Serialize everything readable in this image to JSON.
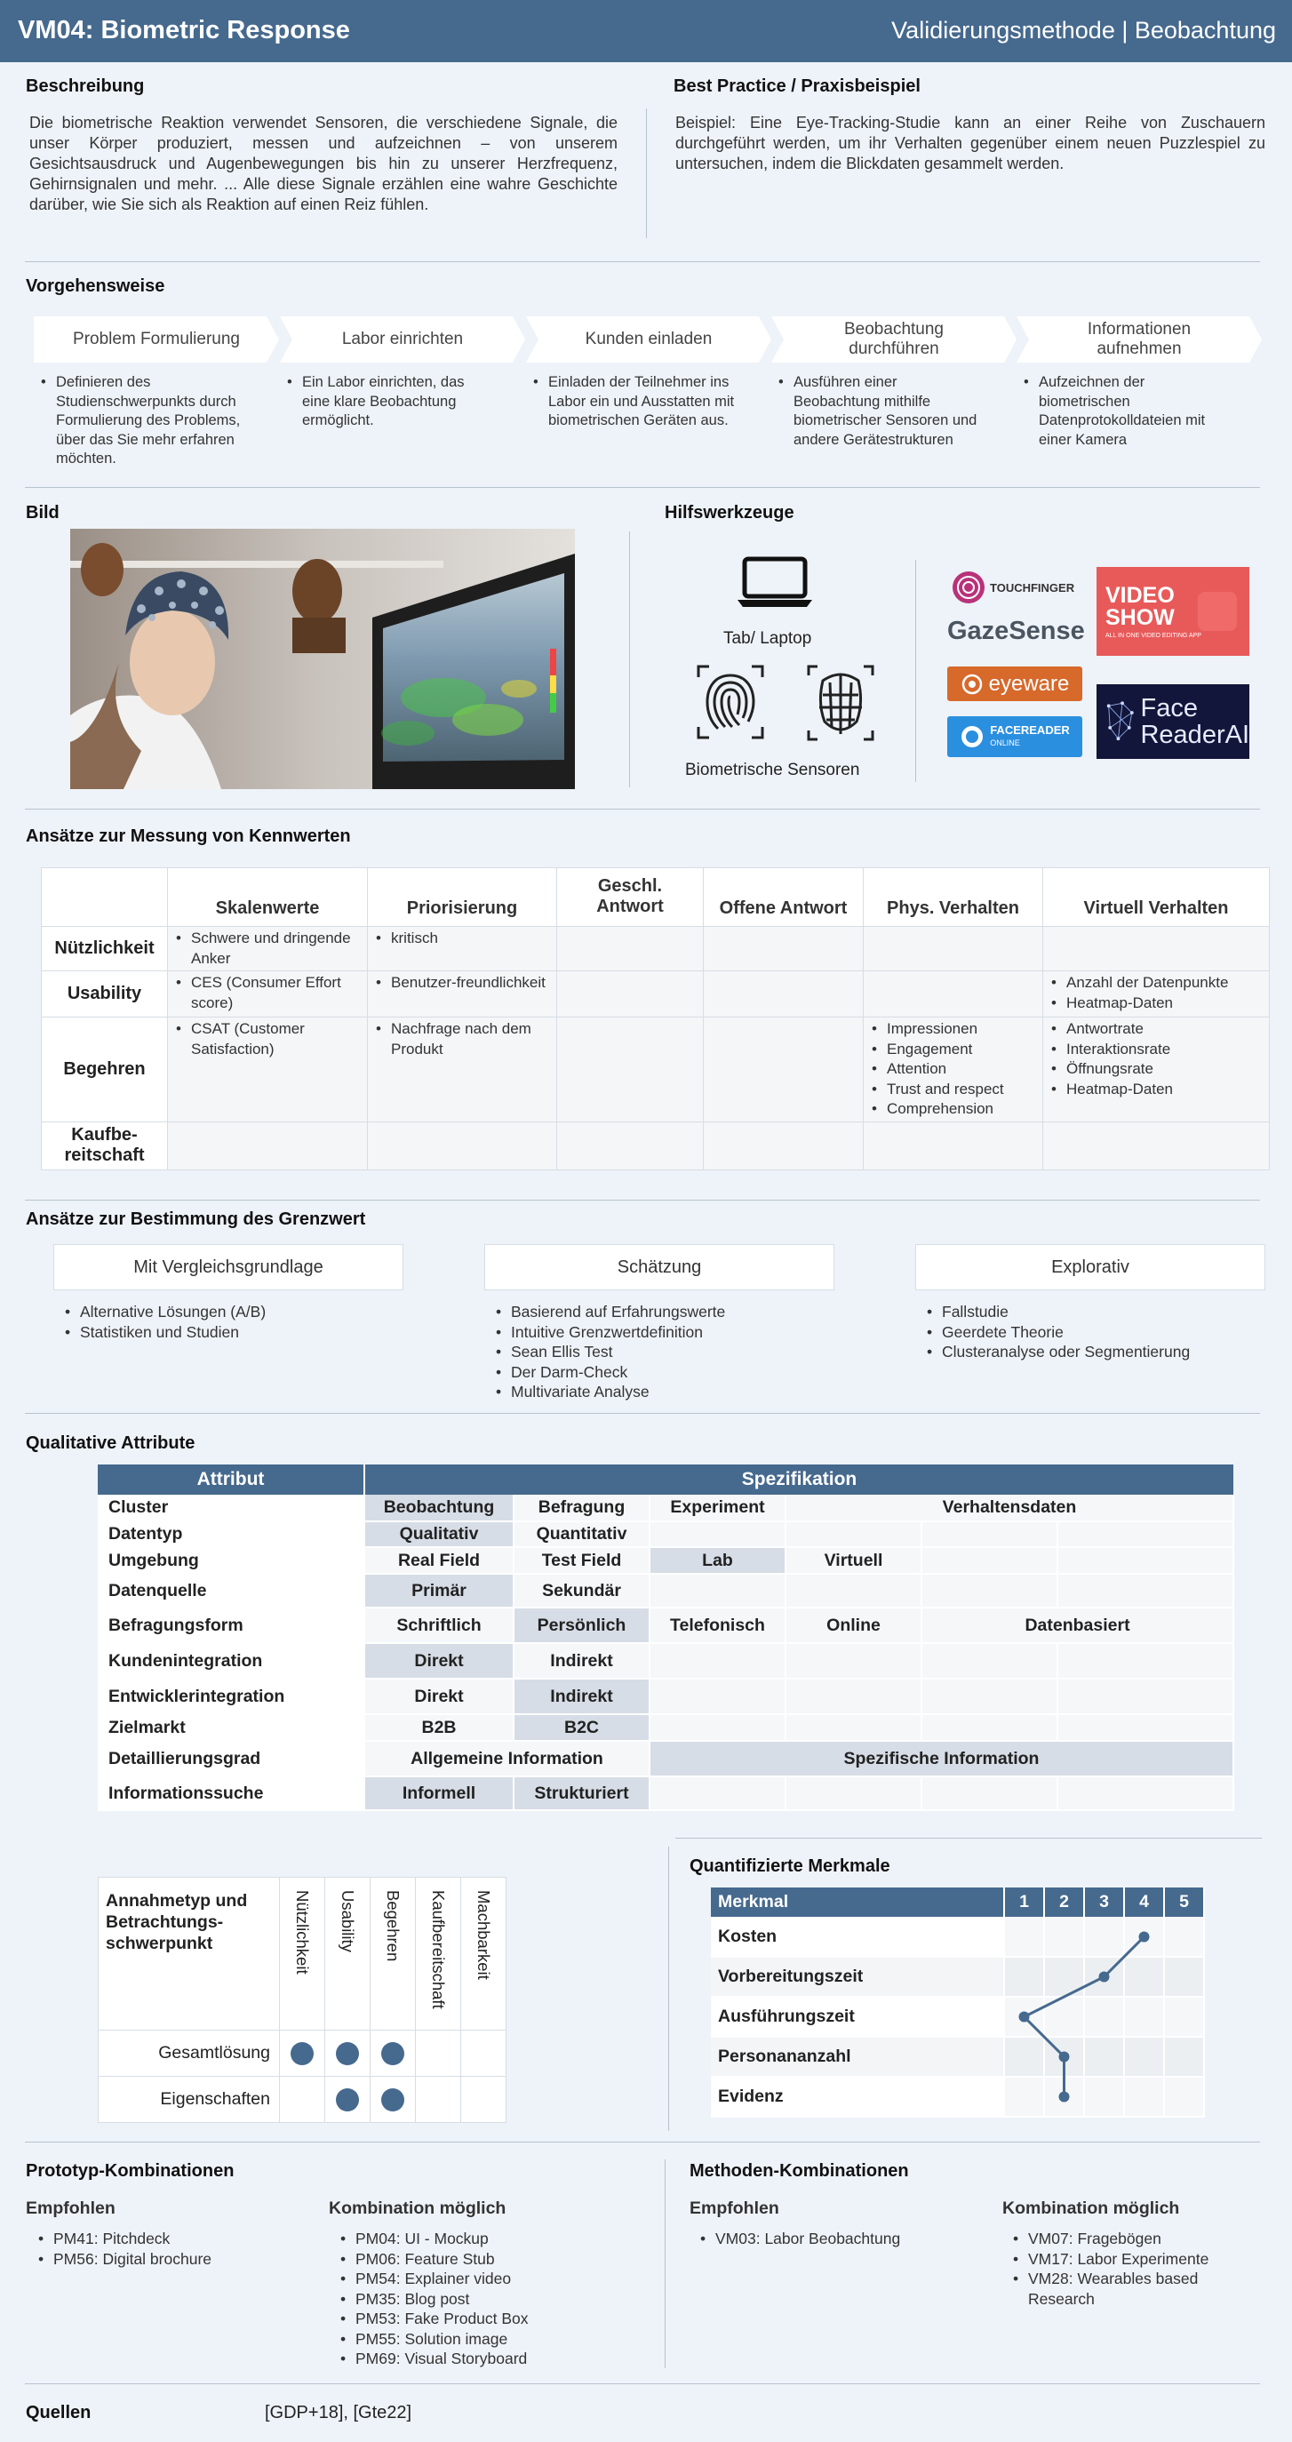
{
  "header": {
    "title": "VM04: Biometric Response",
    "subtitle": "Validierungsmethode | Beobachtung"
  },
  "beschreibung": {
    "heading": "Beschreibung",
    "text": "Die biometrische Reaktion verwendet Sensoren, die verschiedene Signale, die unser Körper produziert, messen und aufzeichnen – von unserem Gesichtsausdruck und Augenbewegungen bis hin zu unserer Herzfrequenz, Gehirnsignalen und mehr. ... Alle diese Signale erzählen eine wahre Geschichte darüber, wie Sie sich als Reaktion auf einen Reiz fühlen."
  },
  "best_practice": {
    "heading": "Best Practice / Praxisbeispiel",
    "text": "Beispiel: Eine Eye-Tracking-Studie kann an einer Reihe von Zuschauern durchgeführt werden, um ihr Verhalten gegenüber einem neuen Puzzlespiel zu untersuchen, indem die Blickdaten gesammelt werden."
  },
  "vorgehensweise": {
    "heading": "Vorgehensweise",
    "steps": [
      {
        "label": "Problem  Formulierung",
        "desc": "Definieren des Studienschwerpunkts durch Formulierung des Problems, über das Sie mehr erfahren möchten."
      },
      {
        "label": "Labor einrichten",
        "desc": "Ein Labor einrichten, das eine klare Beobachtung ermöglicht."
      },
      {
        "label": "Kunden  einladen",
        "desc": "Einladen der Teilnehmer ins Labor ein und Ausstatten mit biometrischen Geräten aus."
      },
      {
        "label": "Beobachtung durchführen",
        "desc": "Ausführen einer Beobachtung mithilfe biometrischer Sensoren und andere Gerätestrukturen"
      },
      {
        "label": "Informationen aufnehmen",
        "desc": "Aufzeichnen der biometrischen Datenprotokolldateien mit einer Kamera"
      }
    ]
  },
  "bild": {
    "heading": "Bild"
  },
  "hilfswerkzeuge": {
    "heading": "Hilfswerkzeuge",
    "laptop_label": "Tab/ Laptop",
    "sensor_label": "Biometrische Sensoren",
    "logos": {
      "touchfinger": "TOUCHFINGER",
      "gazesense": "GazeSense",
      "eyeware": "eyeware",
      "facereader_online": "FACEREADER",
      "facereader_online_sub": "ONLINE",
      "videoshow": "VIDEO SHOW",
      "videoshow_sub": "ALL IN ONE VIDEO EDITING APP",
      "facereader_ai_1": "Face",
      "facereader_ai_2": "ReaderAI"
    }
  },
  "messung": {
    "heading": "Ansätze zur Messung von Kennwerten",
    "columns": [
      "Skalenwerte",
      "Priorisierung",
      "Geschl. Antwort",
      "Offene Antwort",
      "Phys. Verhalten",
      "Virtuell  Verhalten"
    ],
    "rows": [
      {
        "label": "Nützlichkeit",
        "cells": [
          [
            "Schwere und dringende Anker"
          ],
          [
            "kritisch"
          ],
          [],
          [],
          [],
          []
        ]
      },
      {
        "label": "Usability",
        "cells": [
          [
            "CES (Consumer Effort score)"
          ],
          [
            "Benutzer-freundlichkeit"
          ],
          [],
          [],
          [],
          [
            "Anzahl der Datenpunkte",
            "Heatmap-Daten"
          ]
        ]
      },
      {
        "label": "Begehren",
        "cells": [
          [
            "CSAT (Customer Satisfaction)"
          ],
          [
            "Nachfrage nach dem Produkt"
          ],
          [],
          [],
          [
            "Impressionen",
            "Engagement",
            "Attention",
            "Trust and respect",
            "Comprehension"
          ],
          [
            "Antwortrate",
            "Interaktionsrate",
            "Öffnungsrate",
            "Heatmap-Daten"
          ]
        ]
      },
      {
        "label": "Kaufbe-reitschaft",
        "cells": [
          [],
          [],
          [],
          [],
          [],
          []
        ]
      }
    ]
  },
  "grenzwert": {
    "heading": "Ansätze zur Bestimmung des Grenzwert",
    "groups": [
      {
        "label": "Mit Vergleichsgrundlage",
        "items": [
          "Alternative Lösungen (A/B)",
          "Statistiken und Studien"
        ]
      },
      {
        "label": "Schätzung",
        "items": [
          "Basierend auf Erfahrungswerte",
          "Intuitive Grenzwertdefinition",
          "Sean Ellis Test",
          "Der Darm-Check",
          "Multivariate Analyse"
        ]
      },
      {
        "label": "Explorativ",
        "items": [
          "Fallstudie",
          "Geerdete Theorie",
          "Clusteranalyse oder Segmentierung"
        ]
      }
    ]
  },
  "qualitative": {
    "heading": "Qualitative Attribute",
    "col_attr": "Attribut",
    "col_spec": "Spezifikation",
    "rows": [
      {
        "label": "Cluster",
        "cells": [
          [
            "Beobachtung",
            1,
            true
          ],
          [
            "Befragung",
            1,
            false
          ],
          [
            "Experiment",
            1,
            false
          ],
          [
            "Verhaltensdaten",
            3,
            false
          ]
        ]
      },
      {
        "label": "Datentyp",
        "cells": [
          [
            "Qualitativ",
            1,
            true
          ],
          [
            "Quantitativ",
            1,
            false
          ],
          [
            "",
            1,
            false
          ],
          [
            "",
            1,
            false
          ],
          [
            "",
            1,
            false
          ],
          [
            "",
            1,
            false
          ]
        ]
      },
      {
        "label": "Umgebung",
        "cells": [
          [
            "Real Field",
            1,
            false
          ],
          [
            "Test Field",
            1,
            false
          ],
          [
            "Lab",
            1,
            true
          ],
          [
            "Virtuell",
            1,
            false
          ],
          [
            "",
            1,
            false
          ],
          [
            "",
            1,
            false
          ]
        ]
      },
      {
        "label": "Datenquelle",
        "cells": [
          [
            "Primär",
            1,
            true
          ],
          [
            "Sekundär",
            1,
            false
          ],
          [
            "",
            1,
            false
          ],
          [
            "",
            1,
            false
          ],
          [
            "",
            1,
            false
          ],
          [
            "",
            1,
            false
          ]
        ]
      },
      {
        "label": "Befragungsform",
        "cells": [
          [
            "Schriftlich",
            1,
            false
          ],
          [
            "Persönlich",
            1,
            true
          ],
          [
            "Telefonisch",
            1,
            false
          ],
          [
            "Online",
            1,
            false
          ],
          [
            "Datenbasiert",
            2,
            false
          ]
        ]
      },
      {
        "label": "Kundenintegration",
        "cells": [
          [
            "Direkt",
            1,
            true
          ],
          [
            "Indirekt",
            1,
            false
          ],
          [
            "",
            1,
            false
          ],
          [
            "",
            1,
            false
          ],
          [
            "",
            1,
            false
          ],
          [
            "",
            1,
            false
          ]
        ]
      },
      {
        "label": "Entwicklerintegration",
        "cells": [
          [
            "Direkt",
            1,
            false
          ],
          [
            "Indirekt",
            1,
            true
          ],
          [
            "",
            1,
            false
          ],
          [
            "",
            1,
            false
          ],
          [
            "",
            1,
            false
          ],
          [
            "",
            1,
            false
          ]
        ]
      },
      {
        "label": "Zielmarkt",
        "cells": [
          [
            "B2B",
            1,
            false
          ],
          [
            "B2C",
            1,
            true
          ],
          [
            "",
            1,
            false
          ],
          [
            "",
            1,
            false
          ],
          [
            "",
            1,
            false
          ],
          [
            "",
            1,
            false
          ]
        ]
      },
      {
        "label": "Detaillierungsgrad",
        "cells": [
          [
            "Allgemeine  Information",
            2,
            false
          ],
          [
            "Spezifische Information",
            4,
            true
          ]
        ]
      },
      {
        "label": "Informationssuche",
        "cells": [
          [
            "Informell",
            1,
            true
          ],
          [
            "Strukturiert",
            1,
            true
          ],
          [
            "",
            1,
            false
          ],
          [
            "",
            1,
            false
          ],
          [
            "",
            1,
            false
          ],
          [
            "",
            1,
            false
          ]
        ]
      }
    ]
  },
  "annahmetyp": {
    "heading": "Annahmetyp und Betrachtungs-schwerpunkt",
    "columns": [
      "Nützlichkeit",
      "Usability",
      "Begehren",
      "Kaufbereitschaft",
      "Machbarkeit"
    ],
    "rows": [
      {
        "label": "Gesamtlösung",
        "dots": [
          true,
          true,
          true,
          false,
          false
        ]
      },
      {
        "label": "Eigenschaften",
        "dots": [
          false,
          true,
          true,
          false,
          false
        ]
      }
    ]
  },
  "quantifiziert": {
    "heading": "Quantifizierte Merkmale",
    "col_label": "Merkmal",
    "scale": [
      "1",
      "2",
      "3",
      "4",
      "5"
    ],
    "rows": [
      {
        "label": "Kosten",
        "value": 4
      },
      {
        "label": "Vorbereitungszeit",
        "value": 3
      },
      {
        "label": "Ausführungszeit",
        "value": 1
      },
      {
        "label": "Personananzahl",
        "value": 2
      },
      {
        "label": "Evidenz",
        "value": 2
      }
    ]
  },
  "prototyp": {
    "heading": "Prototyp-Kombinationen",
    "empfohlen_label": "Empfohlen",
    "empfohlen": [
      "PM41: Pitchdeck",
      "PM56: Digital brochure"
    ],
    "moeglich_label": "Kombination möglich",
    "moeglich": [
      "PM04: UI - Mockup",
      "PM06: Feature Stub",
      "PM54: Explainer video",
      "PM35: Blog post",
      "PM53: Fake Product Box",
      "PM55: Solution image",
      "PM69: Visual Storyboard"
    ]
  },
  "methoden": {
    "heading": "Methoden-Kombinationen",
    "empfohlen_label": "Empfohlen",
    "empfohlen": [
      "VM03: Labor Beobachtung"
    ],
    "moeglich_label": "Kombination möglich",
    "moeglich": [
      "VM07: Fragebögen",
      "VM17: Labor Experimente",
      "VM28: Wearables based Research"
    ]
  },
  "quellen": {
    "label": "Quellen",
    "value": "[GDP+18], [Gte22]"
  },
  "colors": {
    "header": "#46698e",
    "dot": "#46698e",
    "background": "#eef3f9"
  }
}
